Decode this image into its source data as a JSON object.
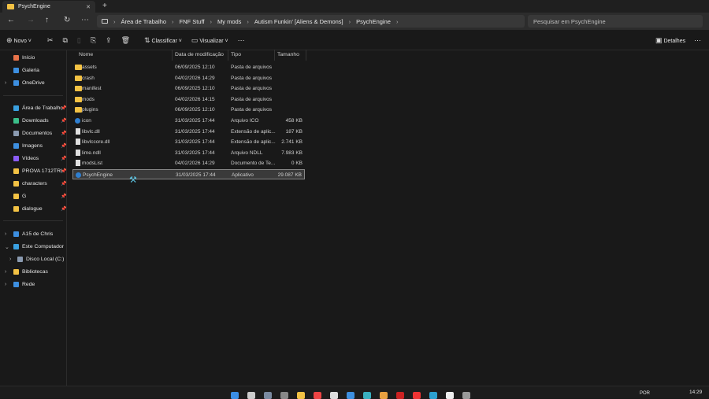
{
  "window": {
    "tab_title": "PsychEngine",
    "close": "✕",
    "new_tab": "+"
  },
  "nav": {
    "back": "←",
    "forward": "→",
    "up": "↑",
    "refresh": "↻",
    "more": "⋯"
  },
  "breadcrumb": [
    "Área de Trabalho",
    "FNF Stuff",
    "My mods",
    "Autism Funkin' [Aliens & Demons]",
    "PsychEngine"
  ],
  "search": {
    "placeholder": "Pesquisar em PsychEngine"
  },
  "toolbar": {
    "new": "Novo",
    "sort": "Classificar",
    "view": "Visualizar",
    "more": "⋯",
    "details": "Detalhes"
  },
  "sidebar": {
    "top": [
      {
        "label": "Início",
        "color": "#e8734a"
      },
      {
        "label": "Galeria",
        "color": "#3d8fe0"
      },
      {
        "label": "OneDrive",
        "color": "#3d8fe0",
        "chevron": true
      }
    ],
    "pinned": [
      {
        "label": "Área de Trabalho",
        "color": "#3aa0e0"
      },
      {
        "label": "Downloads",
        "color": "#3bbf8a"
      },
      {
        "label": "Documentos",
        "color": "#8a9ab0"
      },
      {
        "label": "Imagens",
        "color": "#3d8fe0"
      },
      {
        "label": "Vídeos",
        "color": "#8b5cf6"
      },
      {
        "label": "PROVA 1712TRI",
        "color": "#f3c244"
      },
      {
        "label": "characters",
        "color": "#f3c244"
      },
      {
        "label": "G",
        "color": "#f3c244"
      },
      {
        "label": "dialogue",
        "color": "#f3c244"
      }
    ],
    "devices": [
      {
        "label": "A15 de Chris",
        "color": "#3d8fe0",
        "chevron": "›"
      },
      {
        "label": "Este Computador",
        "color": "#3aa0e0",
        "chevron": "⌄"
      },
      {
        "label": "Disco Local (C:)",
        "color": "#8a9ab0",
        "chevron": "›",
        "indent": true
      },
      {
        "label": "Bibliotecas",
        "color": "#f3c244",
        "chevron": "›"
      },
      {
        "label": "Rede",
        "color": "#3d8fe0",
        "chevron": "›"
      }
    ]
  },
  "columns": {
    "name": "Nome",
    "date": "Data de modificação",
    "type": "Tipo",
    "size": "Tamanho"
  },
  "files": [
    {
      "name": "assets",
      "date": "06/09/2025 12:10",
      "type": "Pasta de arquivos",
      "size": "",
      "icon": "folder"
    },
    {
      "name": "crash",
      "date": "04/02/2026 14:29",
      "type": "Pasta de arquivos",
      "size": "",
      "icon": "folder"
    },
    {
      "name": "manifest",
      "date": "06/09/2025 12:10",
      "type": "Pasta de arquivos",
      "size": "",
      "icon": "folder"
    },
    {
      "name": "mods",
      "date": "04/02/2026 14:15",
      "type": "Pasta de arquivos",
      "size": "",
      "icon": "folder"
    },
    {
      "name": "plugins",
      "date": "06/09/2025 12:10",
      "type": "Pasta de arquivos",
      "size": "",
      "icon": "folder"
    },
    {
      "name": "icon",
      "date": "31/03/2025 17:44",
      "type": "Arquivo ICO",
      "size": "458 KB",
      "icon": "ico"
    },
    {
      "name": "libvlc.dll",
      "date": "31/03/2025 17:44",
      "type": "Extensão de aplic...",
      "size": "187 KB",
      "icon": "file"
    },
    {
      "name": "libvlccore.dll",
      "date": "31/03/2025 17:44",
      "type": "Extensão de aplic...",
      "size": "2.741 KB",
      "icon": "file"
    },
    {
      "name": "lime.ndll",
      "date": "31/03/2025 17:44",
      "type": "Arquivo NDLL",
      "size": "7.983 KB",
      "icon": "file"
    },
    {
      "name": "modsList",
      "date": "04/02/2026 14:29",
      "type": "Documento de Te...",
      "size": "0 KB",
      "icon": "file"
    },
    {
      "name": "PsychEngine",
      "date": "31/03/2025 17:44",
      "type": "Aplicativo",
      "size": "29.087 KB",
      "icon": "ico",
      "selected": true
    }
  ],
  "taskbar": {
    "lang": "POR",
    "time": "14:29"
  }
}
